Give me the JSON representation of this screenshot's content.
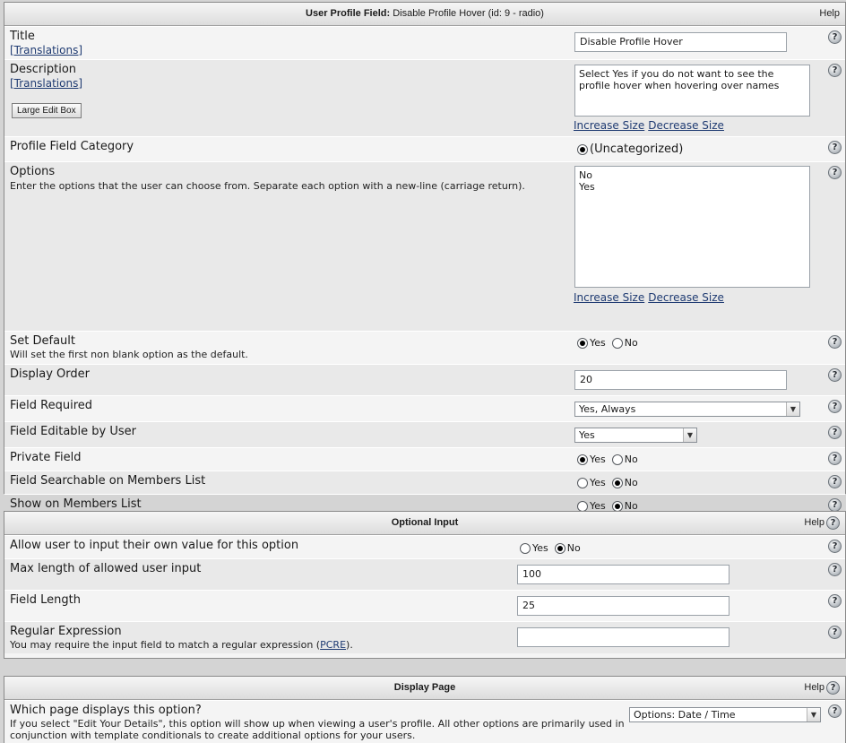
{
  "panel1": {
    "title_bold": "User Profile Field:",
    "title_rest": "Disable Profile Hover (id: 9 - radio)",
    "help": "Help",
    "rows": {
      "title": {
        "label": "Title",
        "translations": "[Translations]",
        "value": "Disable Profile Hover"
      },
      "description": {
        "label": "Description",
        "translations": "[Translations]",
        "large_edit": "Large Edit Box",
        "value": "Select Yes if you do not want to see the\nprofile hover when hovering over names",
        "increase": "Increase Size",
        "decrease": "Decrease Size"
      },
      "category": {
        "label": "Profile Field Category",
        "option": "(Uncategorized)"
      },
      "options": {
        "label": "Options",
        "desc": "Enter the options that the user can choose from. Separate each option with a new-line (carriage return).",
        "value": "No\nYes",
        "increase": "Increase Size",
        "decrease": "Decrease Size"
      },
      "set_default": {
        "label": "Set Default",
        "desc": "Will set the first non blank option as the default.",
        "yes": "Yes",
        "no": "No"
      },
      "display_order": {
        "label": "Display Order",
        "value": "20"
      },
      "field_required": {
        "label": "Field Required",
        "selected": "Yes, Always"
      },
      "field_editable": {
        "label": "Field Editable by User",
        "selected": "Yes"
      },
      "private_field": {
        "label": "Private Field",
        "yes": "Yes",
        "no": "No"
      },
      "searchable": {
        "label": "Field Searchable on Members List",
        "yes": "Yes",
        "no": "No"
      },
      "show_members": {
        "label": "Show on Members List",
        "yes": "Yes",
        "no": "No"
      }
    }
  },
  "panel2": {
    "title": "Optional Input",
    "help": "Help",
    "rows": {
      "allow_input": {
        "label": "Allow user to input their own value for this option",
        "yes": "Yes",
        "no": "No"
      },
      "max_length": {
        "label": "Max length of allowed user input",
        "value": "100"
      },
      "field_length": {
        "label": "Field Length",
        "value": "25"
      },
      "regex": {
        "label": "Regular Expression",
        "desc_before": "You may require the input field to match a regular expression (",
        "pcre": "PCRE",
        "desc_after": ").",
        "value": ""
      }
    }
  },
  "panel3": {
    "title": "Display Page",
    "help": "Help",
    "rows": {
      "which_page": {
        "label": "Which page displays this option?",
        "desc": "If you select \"Edit Your Details\", this option will show up when viewing a user's profile. All other options are primarily used in conjunction with template conditionals to create additional options for your users.",
        "selected": "Options: Date / Time"
      }
    }
  },
  "icons": {
    "help": "question-mark-icon",
    "dropdown": "chevron-down-icon",
    "radio": "radio-icon"
  }
}
